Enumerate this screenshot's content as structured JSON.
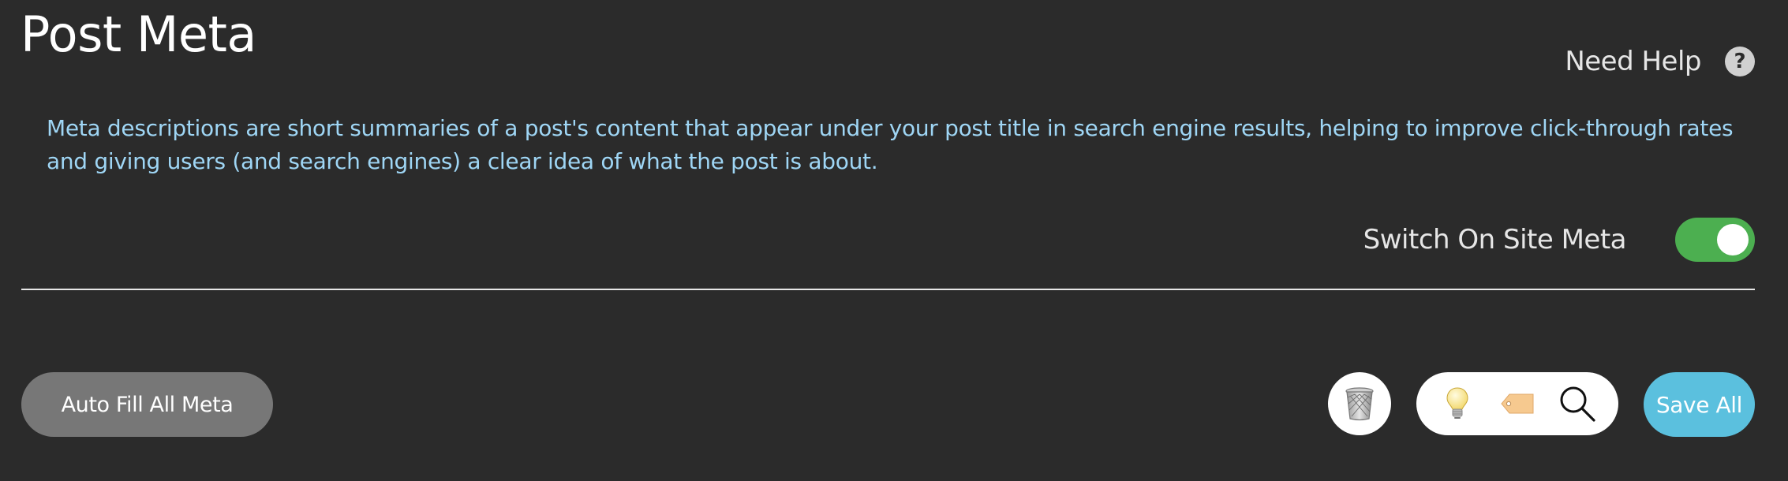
{
  "header": {
    "title": "Post Meta",
    "help_label": "Need Help",
    "help_icon_glyph": "?"
  },
  "description": "Meta descriptions are short summaries of a post's content that appear under your post title in search engine results, helping to improve click-through rates and giving users (and search engines) a clear idea of what the post is about.",
  "site_meta_switch": {
    "label": "Switch On Site Meta",
    "on": true,
    "on_color": "#4caf50"
  },
  "actions": {
    "auto_fill_label": "Auto Fill All Meta",
    "save_all_label": "Save All",
    "save_color": "#5bc0de",
    "icons": [
      "trash-icon",
      "lightbulb-icon",
      "tag-icon",
      "search-icon"
    ]
  },
  "colors": {
    "background": "#2b2b2b",
    "description_text": "#9fd6f5"
  }
}
